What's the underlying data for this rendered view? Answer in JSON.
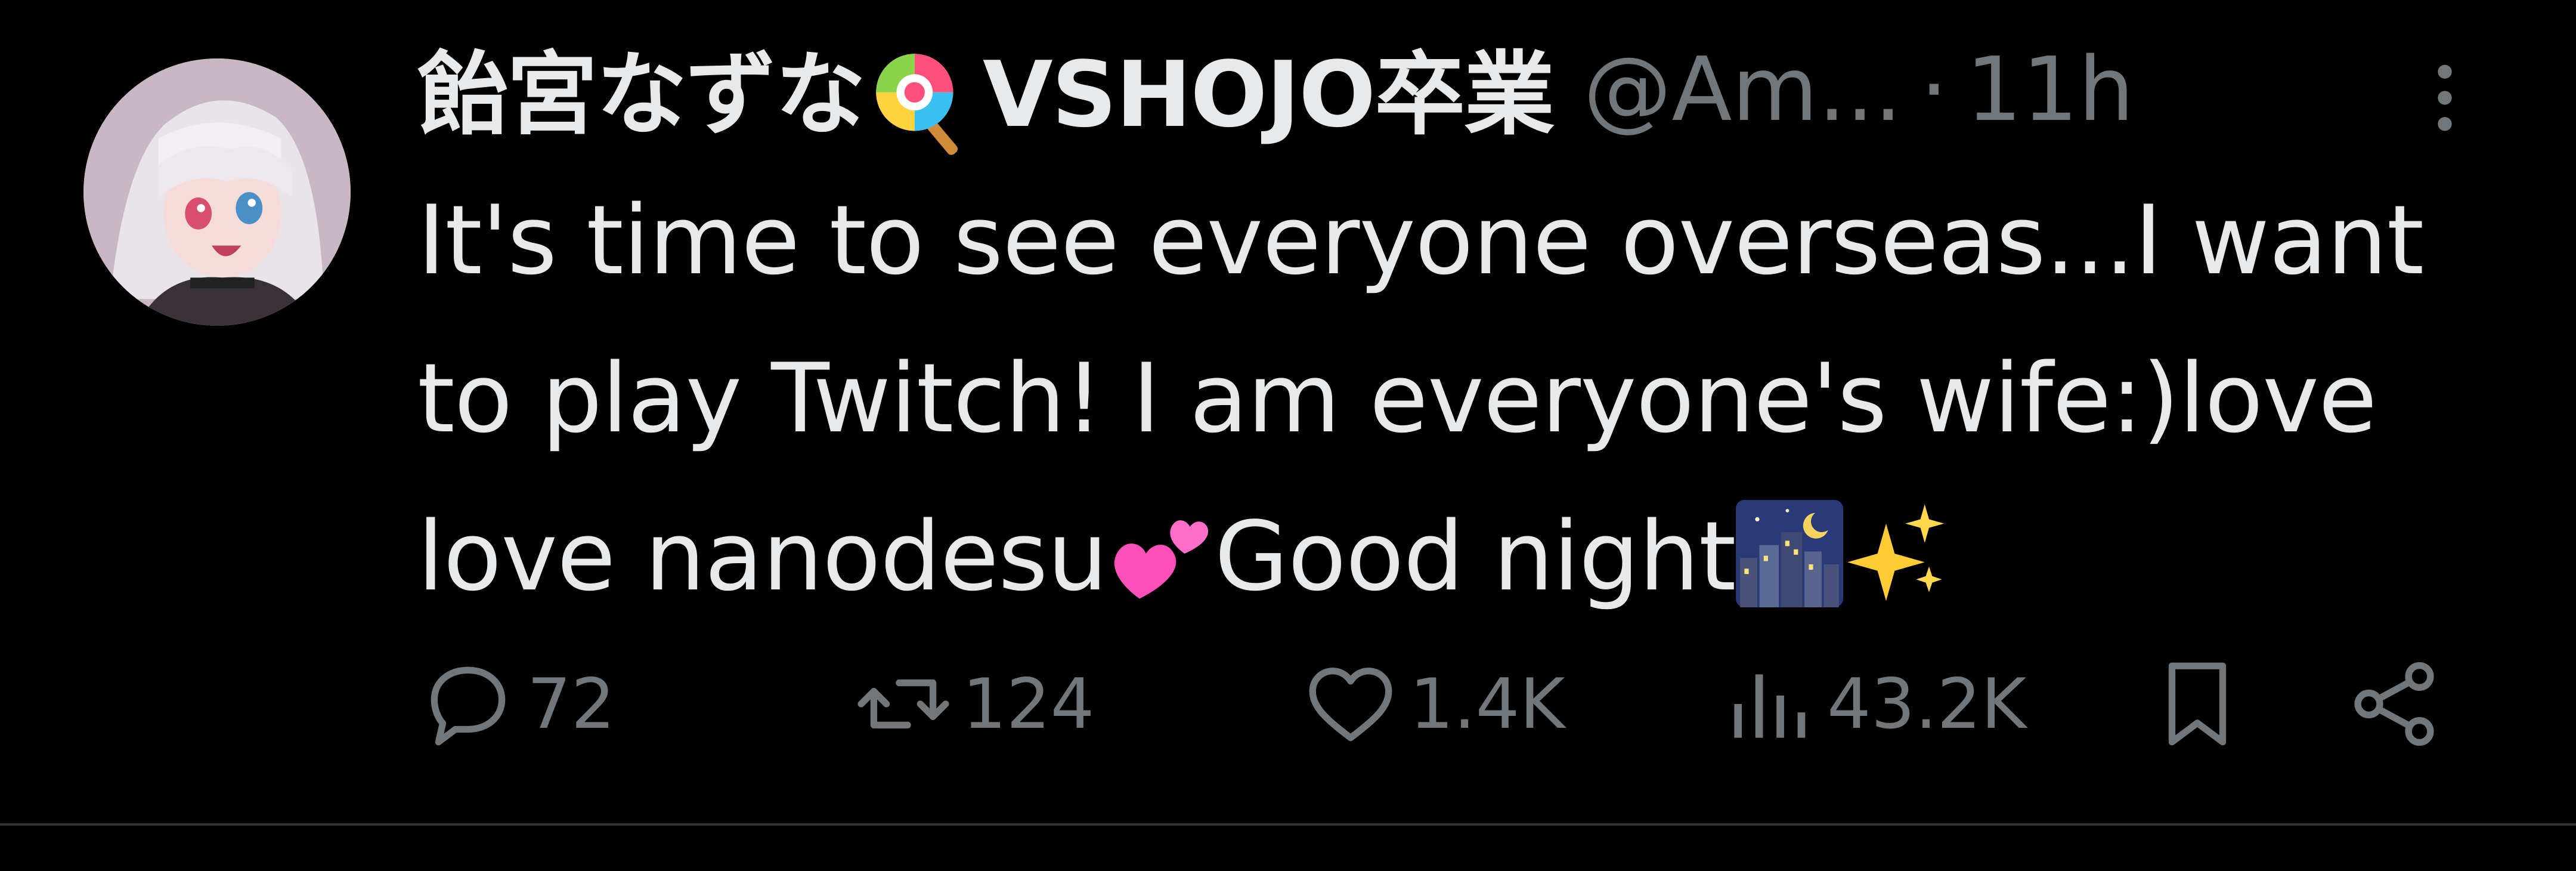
{
  "tweet": {
    "display_name": "飴宮なずな",
    "display_name_suffix": "VSHOJO卒業",
    "name_emoji": "lollipop-emoji",
    "handle": "@Am...",
    "separator": "·",
    "time": "11h",
    "more_icon": "more-vertical-icon",
    "text_lines": {
      "line1": "It's time to see everyone overseas...I want",
      "line2": "to play Twitch! I am everyone's wife:)love",
      "line3_a": "love nanodesu",
      "line3_b": "Good night"
    },
    "inline_emojis": [
      "two-hearts-emoji",
      "night-city-emoji",
      "sparkles-emoji"
    ]
  },
  "actions": {
    "reply": {
      "icon": "reply-icon",
      "count": "72"
    },
    "retweet": {
      "icon": "retweet-icon",
      "count": "124"
    },
    "like": {
      "icon": "heart-icon",
      "count": "1.4K"
    },
    "views": {
      "icon": "views-icon",
      "count": "43.2K"
    },
    "bookmark": {
      "icon": "bookmark-icon"
    },
    "share": {
      "icon": "share-icon"
    }
  },
  "colors": {
    "background": "#000000",
    "text": "#e7e9ea",
    "secondary": "#71767b",
    "divider": "#2f3336"
  }
}
